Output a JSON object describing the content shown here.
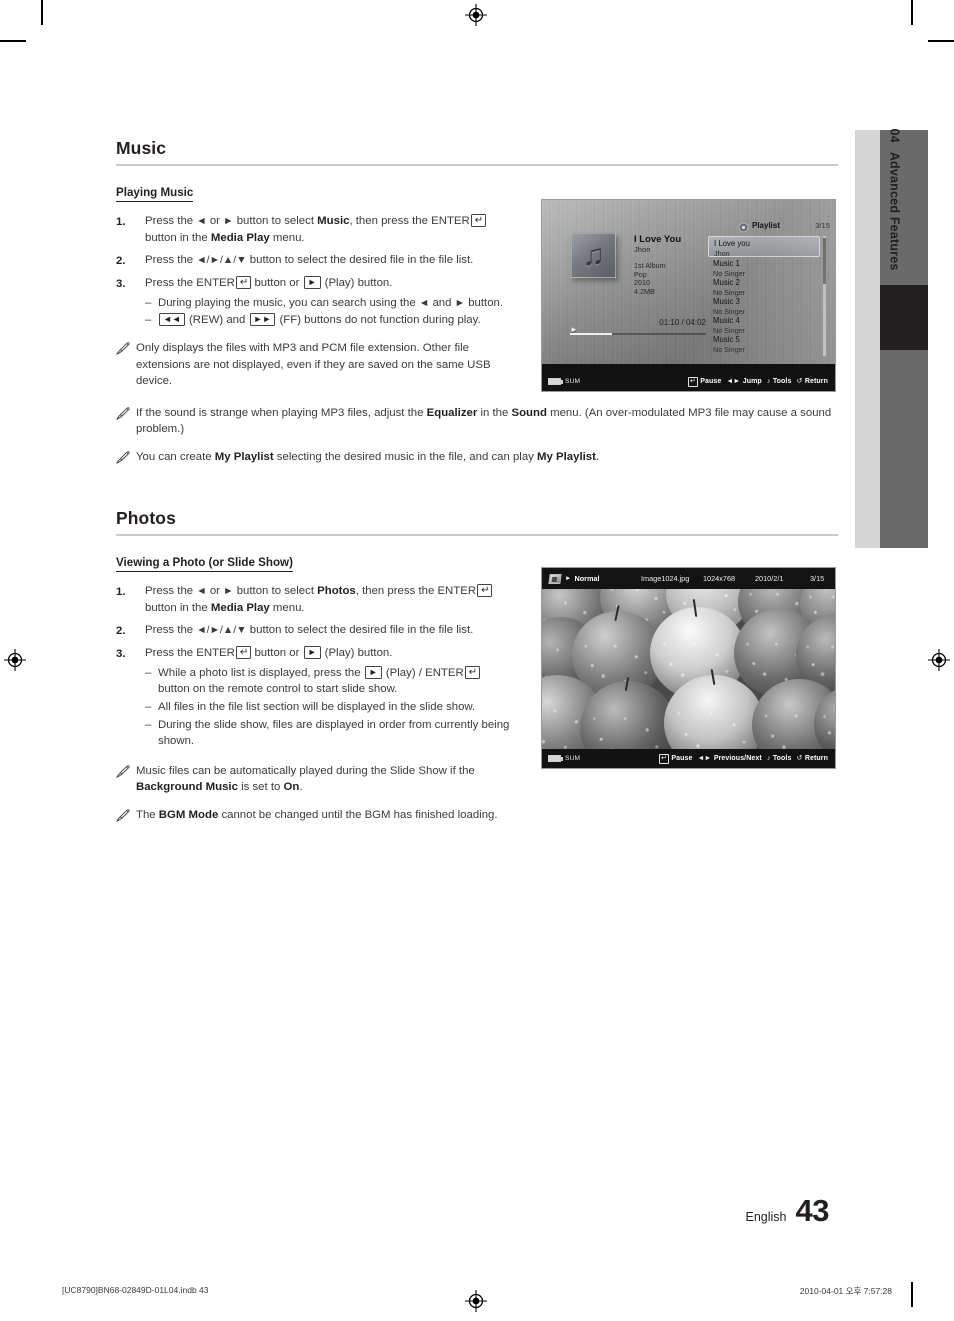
{
  "page": {
    "language_label": "English",
    "page_number": "43",
    "chapter_number": "04",
    "chapter_title": "Advanced Features"
  },
  "print_footer": {
    "file_line": "[UC8790]BN68-02849D-01L04.indb   43",
    "timestamp": "2010-04-01   오후 7:57:28"
  },
  "music_section": {
    "title": "Music",
    "sub_heading": "Playing Music",
    "steps": [
      {
        "num": "1.",
        "parts": [
          {
            "t": "Press the "
          },
          {
            "t": "◄",
            "s": "arrow"
          },
          {
            "t": " or "
          },
          {
            "t": "►",
            "s": "arrow"
          },
          {
            "t": " button to select "
          },
          {
            "t": "Music",
            "s": "b"
          },
          {
            "t": ", then press the ENTER"
          },
          {
            "t": "↵",
            "s": "enter"
          },
          {
            "t": " button in the "
          },
          {
            "t": "Media Play",
            "s": "b"
          },
          {
            "t": " menu."
          }
        ]
      },
      {
        "num": "2.",
        "parts": [
          {
            "t": "Press the "
          },
          {
            "t": "◄/►/▲/▼",
            "s": "arrow"
          },
          {
            "t": " button to select the desired file in the file list."
          }
        ]
      },
      {
        "num": "3.",
        "parts": [
          {
            "t": "Press the ENTER"
          },
          {
            "t": "↵",
            "s": "enter"
          },
          {
            "t": " button or "
          },
          {
            "t": "►",
            "s": "key"
          },
          {
            "t": " (Play) button."
          }
        ]
      }
    ],
    "dashes": [
      [
        {
          "t": "During playing the music, you can search using the "
        },
        {
          "t": "◄",
          "s": "arrow"
        },
        {
          "t": " and "
        },
        {
          "t": "►",
          "s": "arrow"
        },
        {
          "t": " button."
        }
      ],
      [
        {
          "t": "◄◄",
          "s": "key"
        },
        {
          "t": " (REW) and "
        },
        {
          "t": "►►",
          "s": "key"
        },
        {
          "t": " (FF) buttons do not function during play."
        }
      ]
    ],
    "notes": [
      [
        {
          "t": "Only displays the files with MP3 and PCM file extension. Other file extensions are not displayed, even if they are saved on the same USB device."
        }
      ],
      [
        {
          "t": "If the sound is strange when playing MP3 files, adjust the "
        },
        {
          "t": "Equalizer",
          "s": "b"
        },
        {
          "t": " in the "
        },
        {
          "t": "Sound",
          "s": "b"
        },
        {
          "t": " menu. (An over-modulated MP3 file may cause a sound problem.)"
        }
      ],
      [
        {
          "t": "You can create "
        },
        {
          "t": "My Playlist",
          "s": "b"
        },
        {
          "t": " selecting the desired music in the file, and can play "
        },
        {
          "t": "My Playlist",
          "s": "b"
        },
        {
          "t": "."
        }
      ]
    ]
  },
  "photos_section": {
    "title": "Photos",
    "sub_heading": "Viewing a Photo (or Slide Show)",
    "steps": [
      {
        "num": "1.",
        "parts": [
          {
            "t": "Press the "
          },
          {
            "t": "◄",
            "s": "arrow"
          },
          {
            "t": " or "
          },
          {
            "t": "►",
            "s": "arrow"
          },
          {
            "t": " button to select "
          },
          {
            "t": "Photos",
            "s": "b"
          },
          {
            "t": ", then press the ENTER"
          },
          {
            "t": "↵",
            "s": "enter"
          },
          {
            "t": " button in the "
          },
          {
            "t": "Media Play",
            "s": "b"
          },
          {
            "t": " menu."
          }
        ]
      },
      {
        "num": "2.",
        "parts": [
          {
            "t": "Press the "
          },
          {
            "t": "◄/►/▲/▼",
            "s": "arrow"
          },
          {
            "t": " button to select the desired file in the file list."
          }
        ]
      },
      {
        "num": "3.",
        "parts": [
          {
            "t": "Press the ENTER"
          },
          {
            "t": "↵",
            "s": "enter"
          },
          {
            "t": " button or "
          },
          {
            "t": "►",
            "s": "key"
          },
          {
            "t": " (Play) button."
          }
        ]
      }
    ],
    "dashes": [
      [
        {
          "t": "While a photo list is displayed, press the "
        },
        {
          "t": "►",
          "s": "key"
        },
        {
          "t": " (Play) / ENTER"
        },
        {
          "t": "↵",
          "s": "enter"
        },
        {
          "t": " button on the remote control to start slide show."
        }
      ],
      [
        {
          "t": "All files in the file list section will be displayed in the slide show."
        }
      ],
      [
        {
          "t": "During the slide show, files are displayed in order from currently being shown."
        }
      ]
    ],
    "notes": [
      [
        {
          "t": "Music files can be automatically played during the Slide Show if the "
        },
        {
          "t": "Background Music",
          "s": "b"
        },
        {
          "t": " is set to "
        },
        {
          "t": "On",
          "s": "b"
        },
        {
          "t": "."
        }
      ],
      [
        {
          "t": "The "
        },
        {
          "t": "BGM Mode",
          "s": "b"
        },
        {
          "t": " cannot be changed until the BGM has finished loading."
        }
      ]
    ]
  },
  "music_player_screenshot": {
    "now_playing": {
      "title": "I Love You",
      "artist": "Jhon",
      "album": "1st Album",
      "genre": "Pop",
      "year": "2010",
      "size": "4.2MB"
    },
    "time": "01:10 / 04:02",
    "playlist_label": "Playlist",
    "counter": "3/15",
    "tracks": [
      {
        "title": "I Love you",
        "artist": "Jhon",
        "selected": true
      },
      {
        "title": "Music 1",
        "artist": "No Singer",
        "selected": false
      },
      {
        "title": "Music 2",
        "artist": "No Singer",
        "selected": false
      },
      {
        "title": "Music 3",
        "artist": "No Singer",
        "selected": false
      },
      {
        "title": "Music 4",
        "artist": "No Singer",
        "selected": false
      },
      {
        "title": "Music 5",
        "artist": "No Singer",
        "selected": false
      }
    ],
    "footer": {
      "device": "SUM",
      "keys": [
        {
          "glyph": "↵",
          "label": "Pause"
        },
        {
          "glyph": "◄►",
          "label": "Jump"
        },
        {
          "glyph": "♪",
          "label": "Tools"
        },
        {
          "glyph": "↺",
          "label": "Return"
        }
      ]
    }
  },
  "photo_viewer_screenshot": {
    "mode": "Normal",
    "filename": "Image1024.jpg",
    "resolution": "1024x768",
    "date": "2010/2/1",
    "counter": "3/15",
    "footer": {
      "device": "SUM",
      "keys": [
        {
          "glyph": "↵",
          "label": "Pause"
        },
        {
          "glyph": "◄►",
          "label": "Previous/Next"
        },
        {
          "glyph": "♪",
          "label": "Tools"
        },
        {
          "glyph": "↺",
          "label": "Return"
        }
      ]
    }
  },
  "colors": {
    "ink": "#231f20",
    "body_text": "#3b3b3b",
    "rule": "#c9c9c9",
    "tab_light": "#d5d5d5",
    "tab_dark": "#6a6a6a",
    "tab_active": "#231f20"
  }
}
